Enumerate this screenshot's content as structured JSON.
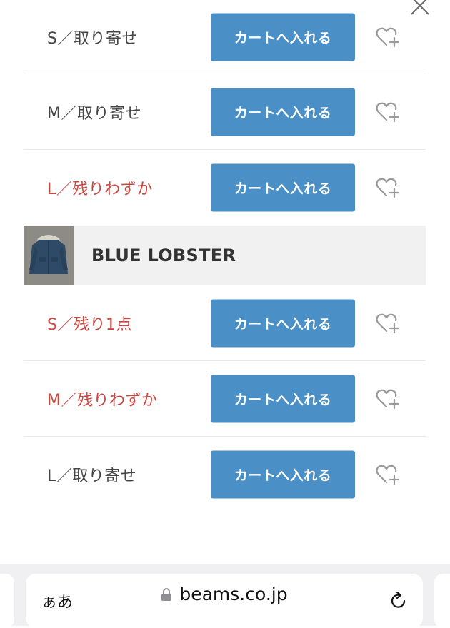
{
  "close": {
    "icon": "close-icon"
  },
  "groups": [
    {
      "brand": null,
      "rows": [
        {
          "size": "S／取り寄せ",
          "status": "normal",
          "button": "カートへ入れる"
        },
        {
          "size": "M／取り寄せ",
          "status": "normal",
          "button": "カートへ入れる"
        },
        {
          "size": "L／残りわずか",
          "status": "low",
          "button": "カートへ入れる"
        }
      ]
    },
    {
      "brand": "BLUE LOBSTER",
      "rows": [
        {
          "size": "S／残り1点",
          "status": "low",
          "button": "カートへ入れる"
        },
        {
          "size": "M／残りわずか",
          "status": "low",
          "button": "カートへ入れる"
        },
        {
          "size": "L／取り寄せ",
          "status": "normal",
          "button": "カートへ入れる"
        }
      ]
    }
  ],
  "colors": {
    "button": "#4a90c7",
    "low_stock": "#c9473f",
    "normal": "#444444"
  },
  "browser": {
    "text_size": "ぁあ",
    "url": "beams.co.jp",
    "lock_icon": "lock-icon",
    "reload_icon": "reload-icon"
  }
}
